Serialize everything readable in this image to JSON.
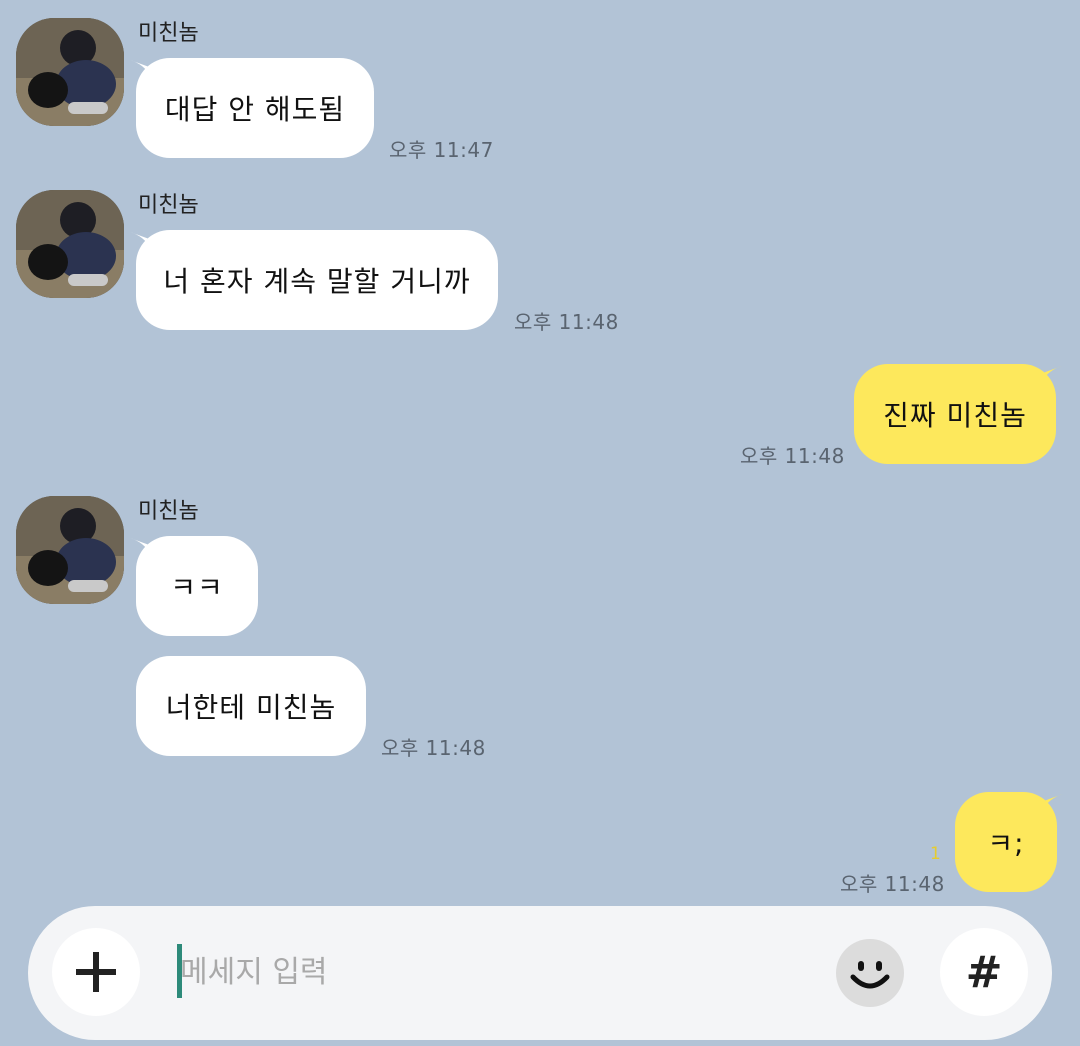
{
  "messages": [
    {
      "sender": "미친놈",
      "text": "대답 안 해도됨",
      "time": "오후 11:47"
    },
    {
      "sender": "미친놈",
      "text": "너 혼자 계속 말할 거니까",
      "time": "오후 11:48"
    },
    {
      "text": "진짜 미친놈",
      "time": "오후 11:48"
    },
    {
      "sender": "미친놈",
      "text": "ㅋㅋ"
    },
    {
      "text": "너한테 미친놈",
      "time": "오후 11:48"
    },
    {
      "text": "ㅋ;",
      "time": "오후 11:48",
      "unread": "1"
    }
  ],
  "input": {
    "placeholder": "메세지 입력",
    "value": ""
  },
  "buttons": {
    "plus_icon": "plus-icon",
    "emoji_icon": "smiley-icon",
    "hash_label": "#"
  },
  "colors": {
    "background": "#b2c3d6",
    "incoming_bubble": "#ffffff",
    "outgoing_bubble": "#fde85c",
    "unread_count": "#e6cc2f",
    "caret": "#2d8a7a"
  }
}
